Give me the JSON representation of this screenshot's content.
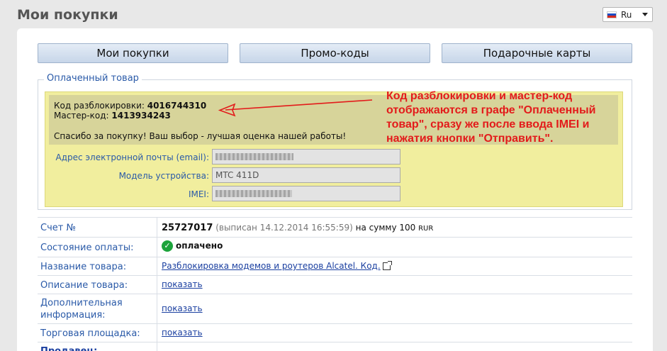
{
  "page": {
    "title": "Мои покупки"
  },
  "language": {
    "selected": "Ru"
  },
  "tabs": [
    {
      "label": "Мои покупки"
    },
    {
      "label": "Промо-коды"
    },
    {
      "label": "Подарочные карты"
    }
  ],
  "paid_goods": {
    "legend": "Оплаченный товар",
    "unlock_label": "Код разблокировки:",
    "unlock_code": "4016744310",
    "master_label": "Мастер-код:",
    "master_code": "1413934243",
    "thanks": "Спасибо за покупку! Ваш выбор - лучшая оценка нашей работы!",
    "email_label": "Адрес электронной почты (email):",
    "model_label": "Модель устройства:",
    "model_value": "MTC 411D",
    "imei_label": "IMEI:"
  },
  "annotation": {
    "line1": "Код разблокировки и мастер-код",
    "line2": "отображаются в графе \"Оплаченный",
    "line3": "товар\", сразу же после ввода IMEI и",
    "line4": "нажатия кнопки \"Отправить\"."
  },
  "details": {
    "invoice_label": "Счет №",
    "invoice_number": "25727017",
    "invoice_issued": "(выписан 14.12.2014 16:55:59)",
    "invoice_sum_text": "на сумму 100",
    "invoice_currency": "RUR",
    "status_label": "Состояние оплаты:",
    "status_value": "оплачено",
    "product_label": "Название товара:",
    "product_value": "Разблокировка модемов и роутеров Alcatel. Код.",
    "description_label": "Описание товара:",
    "description_link": "показать",
    "additional_label_1": "Дополнительная",
    "additional_label_2": "информация:",
    "additional_link": "показать",
    "marketplace_label": "Торговая площадка:",
    "marketplace_link": "показать",
    "seller_label": "Продавец:"
  },
  "colors": {
    "accent_blue": "#2a5aa8",
    "annotation_red": "#e31b1b",
    "paid_box_bg": "#f1ee9e",
    "status_green": "#1ca33b"
  }
}
